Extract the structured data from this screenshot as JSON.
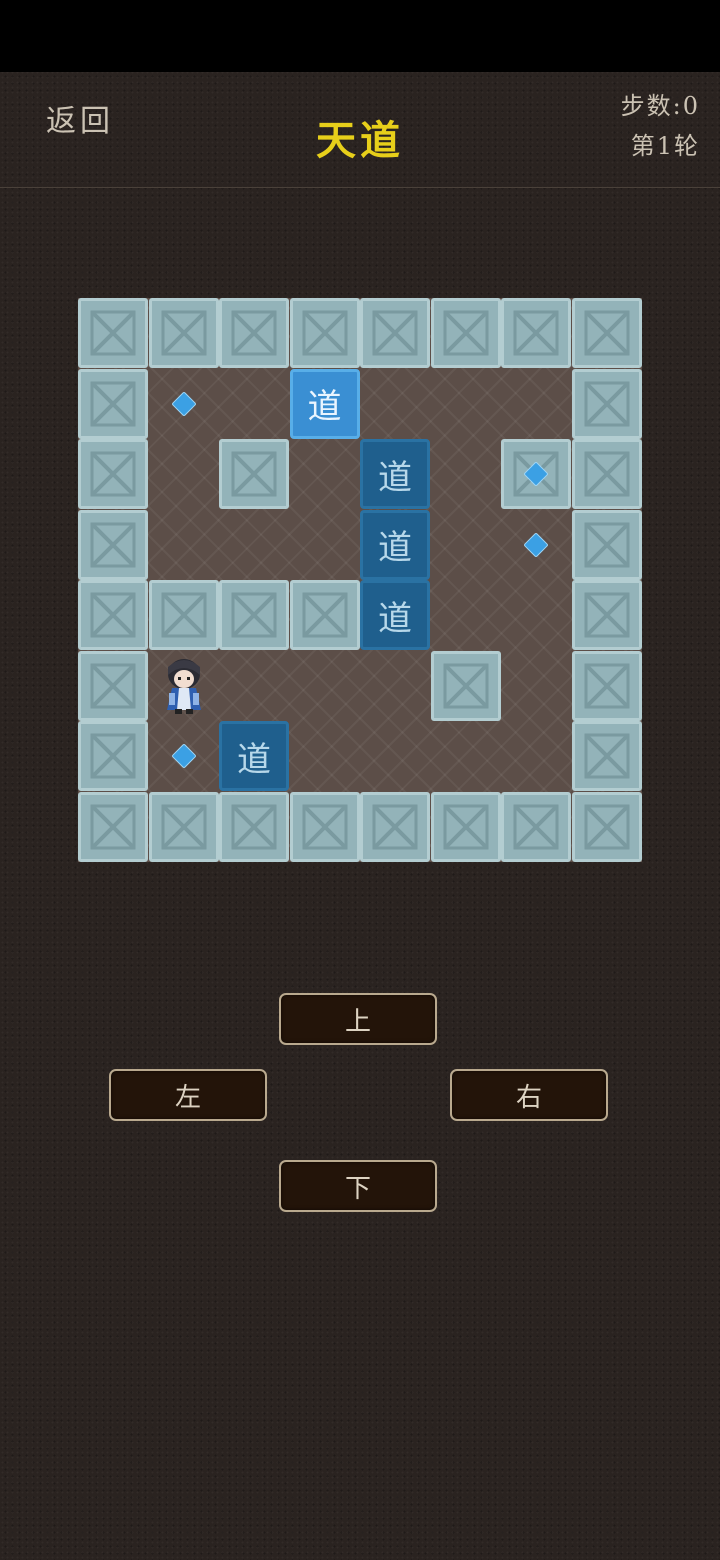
{
  "header": {
    "back_label": "返回",
    "title": "天道",
    "steps_label": "步数:0",
    "round_label": "第1轮"
  },
  "board": {
    "rows": 8,
    "cols": 8,
    "walls": [
      [
        0,
        0
      ],
      [
        0,
        1
      ],
      [
        0,
        2
      ],
      [
        0,
        3
      ],
      [
        0,
        4
      ],
      [
        0,
        5
      ],
      [
        0,
        6
      ],
      [
        0,
        7
      ],
      [
        1,
        0
      ],
      [
        1,
        7
      ],
      [
        2,
        0
      ],
      [
        2,
        2
      ],
      [
        2,
        6
      ],
      [
        2,
        7
      ],
      [
        3,
        0
      ],
      [
        3,
        7
      ],
      [
        4,
        0
      ],
      [
        4,
        1
      ],
      [
        4,
        2
      ],
      [
        4,
        3
      ],
      [
        4,
        7
      ],
      [
        5,
        0
      ],
      [
        5,
        5
      ],
      [
        5,
        7
      ],
      [
        6,
        0
      ],
      [
        6,
        7
      ],
      [
        7,
        0
      ],
      [
        7,
        1
      ],
      [
        7,
        2
      ],
      [
        7,
        3
      ],
      [
        7,
        4
      ],
      [
        7,
        5
      ],
      [
        7,
        6
      ],
      [
        7,
        7
      ]
    ],
    "boxes": [
      {
        "row": 1,
        "col": 3,
        "label": "道",
        "active": true
      },
      {
        "row": 2,
        "col": 4,
        "label": "道",
        "active": false
      },
      {
        "row": 3,
        "col": 4,
        "label": "道",
        "active": false
      },
      {
        "row": 4,
        "col": 4,
        "label": "道",
        "active": false
      },
      {
        "row": 6,
        "col": 2,
        "label": "道",
        "active": false
      }
    ],
    "targets": [
      [
        1,
        1
      ],
      [
        2,
        6
      ],
      [
        3,
        6
      ],
      [
        6,
        1
      ]
    ],
    "player": {
      "row": 5,
      "col": 1
    }
  },
  "controls": {
    "up_label": "上",
    "left_label": "左",
    "right_label": "右",
    "down_label": "下"
  },
  "colors": {
    "title": "#e7cf1a",
    "wall": "#93b3b9",
    "box": "#1f5f8d",
    "box_active": "#3a8fd3",
    "target": "#3ba0e4"
  }
}
